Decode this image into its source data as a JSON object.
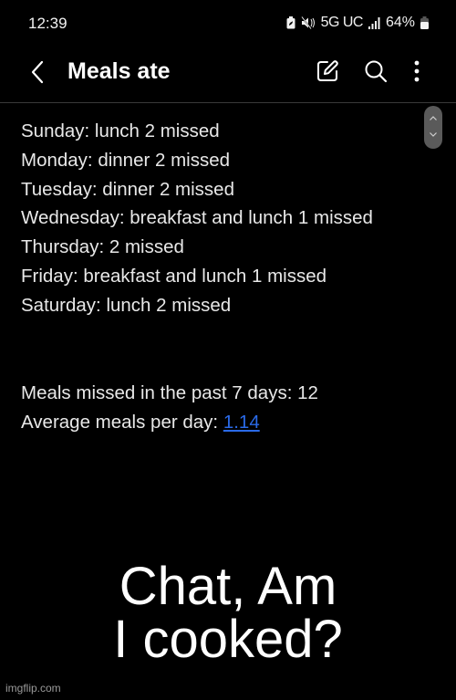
{
  "status_bar": {
    "time": "12:39",
    "network": "5G UC",
    "battery": "64%",
    "icons": [
      "battery-saver-icon",
      "mute-icon",
      "signal-icon",
      "battery-icon"
    ]
  },
  "app_bar": {
    "title": "Meals ate",
    "icons": {
      "back": "back-chevron-icon",
      "edit": "edit-icon",
      "search": "search-icon",
      "more": "more-vertical-icon"
    }
  },
  "note": {
    "lines": [
      "Sunday: lunch 2 missed",
      "Monday: dinner 2 missed",
      "Tuesday: dinner 2 missed",
      "Wednesday: breakfast and lunch 1 missed",
      "Thursday: 2 missed",
      "Friday: breakfast and lunch 1 missed",
      "Saturday: lunch 2 missed"
    ],
    "summary": {
      "missed_label": "Meals missed in the past 7 days: 12",
      "average_label": "Average meals per day: ",
      "average_value": "1.14"
    }
  },
  "caption": {
    "line1": "Chat, Am",
    "line2": "I cooked?"
  },
  "watermark": "imgflip.com",
  "colors": {
    "background": "#000000",
    "text": "#e8e8e8",
    "link": "#2a6ae8",
    "scroll_handle": "#5a5a5a"
  }
}
